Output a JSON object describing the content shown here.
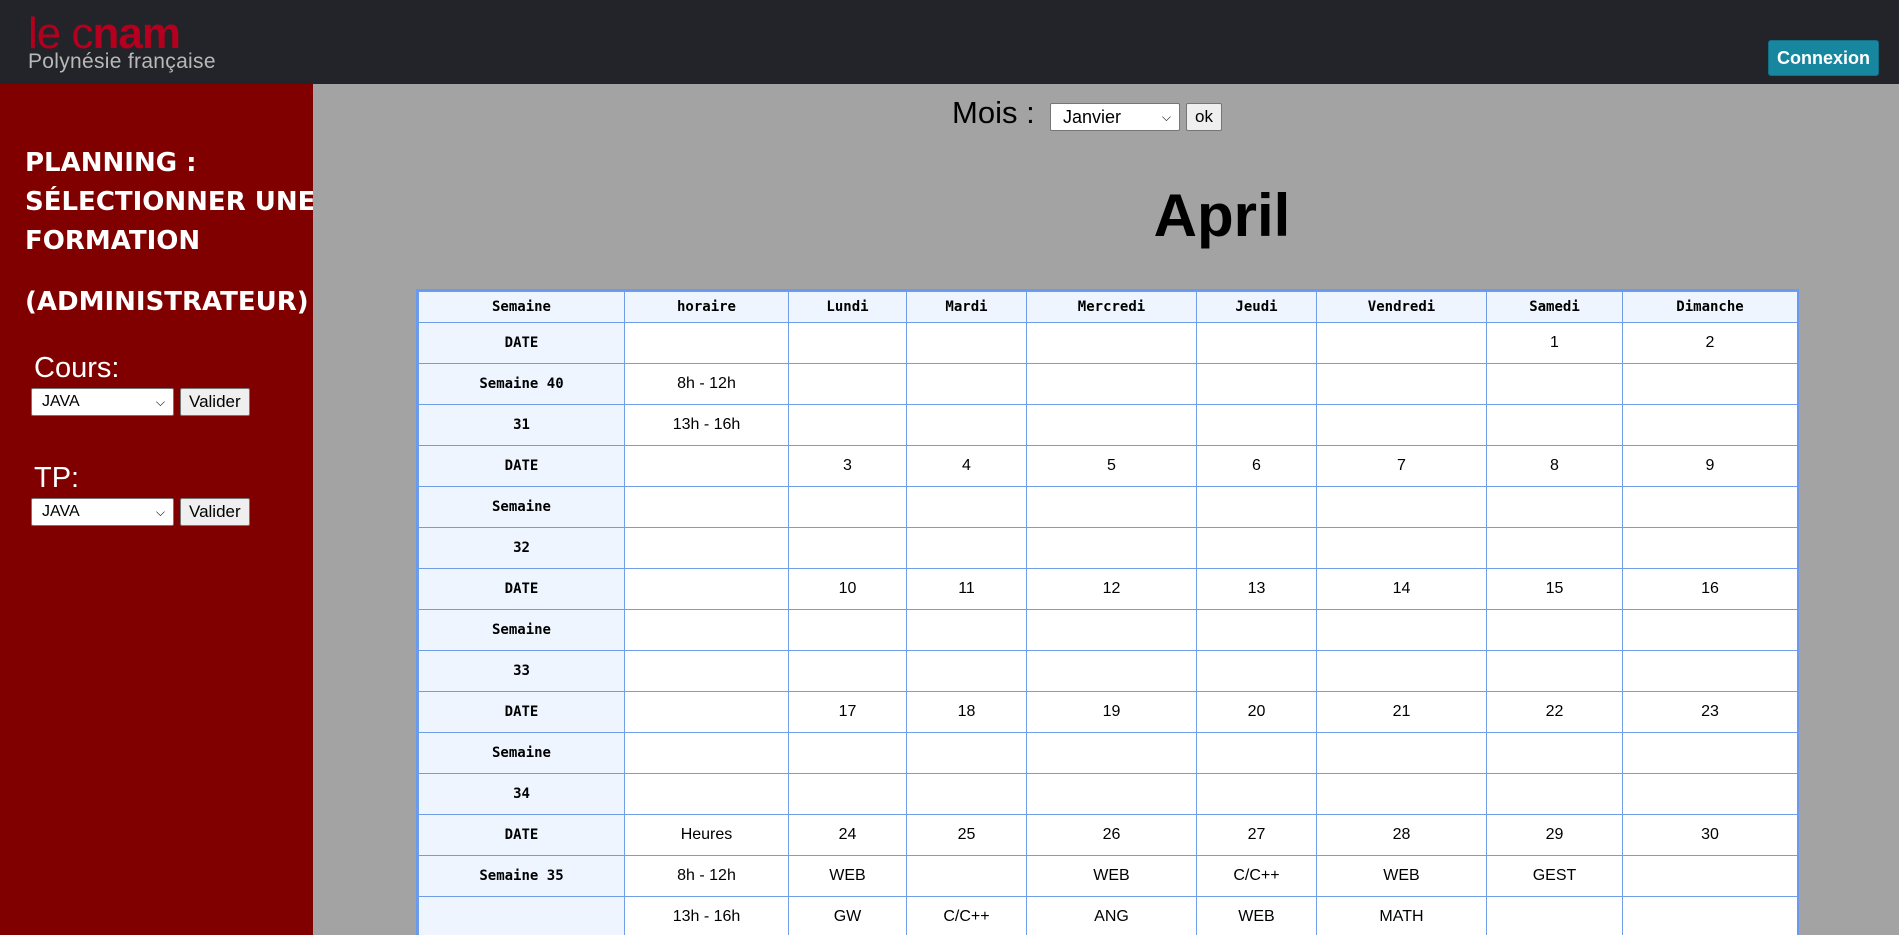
{
  "header": {
    "logo_word_light": "le c",
    "logo_word_bold": "nam",
    "logo_subtitle": "Polynésie française",
    "connexion_label": "Connexion"
  },
  "sidebar": {
    "title": "Planning : Sélectionner une formation",
    "admin": "(Administrateur)",
    "cours_label": "Cours:",
    "cours_selected": "JAVA",
    "cours_button": "Valider",
    "tp_label": "TP:",
    "tp_selected": "JAVA",
    "tp_button": "Valider"
  },
  "filter": {
    "mois_label": "Mois :",
    "mois_selected": "Janvier",
    "ok_label": "ok"
  },
  "month_title": "April",
  "calendar": {
    "headers": [
      "Semaine",
      "horaire",
      "Lundi",
      "Mardi",
      "Mercredi",
      "Jeudi",
      "Vendredi",
      "Samedi",
      "Dimanche"
    ],
    "rows": [
      [
        "DATE",
        "",
        "",
        "",
        "",
        "",
        "",
        "1",
        "2"
      ],
      [
        "Semaine 40",
        "8h - 12h",
        "",
        "",
        "",
        "",
        "",
        "",
        ""
      ],
      [
        "31",
        "13h - 16h",
        "",
        "",
        "",
        "",
        "",
        "",
        ""
      ],
      [
        "DATE",
        "",
        "3",
        "4",
        "5",
        "6",
        "7",
        "8",
        "9"
      ],
      [
        "Semaine",
        "",
        "",
        "",
        "",
        "",
        "",
        "",
        ""
      ],
      [
        "32",
        "",
        "",
        "",
        "",
        "",
        "",
        "",
        ""
      ],
      [
        "DATE",
        "",
        "10",
        "11",
        "12",
        "13",
        "14",
        "15",
        "16"
      ],
      [
        "Semaine",
        "",
        "",
        "",
        "",
        "",
        "",
        "",
        ""
      ],
      [
        "33",
        "",
        "",
        "",
        "",
        "",
        "",
        "",
        ""
      ],
      [
        "DATE",
        "",
        "17",
        "18",
        "19",
        "20",
        "21",
        "22",
        "23"
      ],
      [
        "Semaine",
        "",
        "",
        "",
        "",
        "",
        "",
        "",
        ""
      ],
      [
        "34",
        "",
        "",
        "",
        "",
        "",
        "",
        "",
        ""
      ],
      [
        "DATE",
        "Heures",
        "24",
        "25",
        "26",
        "27",
        "28",
        "29",
        "30"
      ],
      [
        "Semaine 35",
        "8h - 12h",
        "WEB",
        "",
        "WEB",
        "C/C++",
        "WEB",
        "GEST",
        ""
      ],
      [
        "",
        "13h - 16h",
        "GW",
        "C/C++",
        "ANG",
        "WEB",
        "MATH",
        "",
        ""
      ]
    ]
  },
  "colors": {
    "topbar": "#222429",
    "sidebar": "#800000",
    "page_bg": "#a3a3a3",
    "connexion_btn": "#17879f",
    "logo_red": "#b4001e",
    "grid_border": "#6f9de8",
    "header_cell_bg": "#eef5ff"
  }
}
